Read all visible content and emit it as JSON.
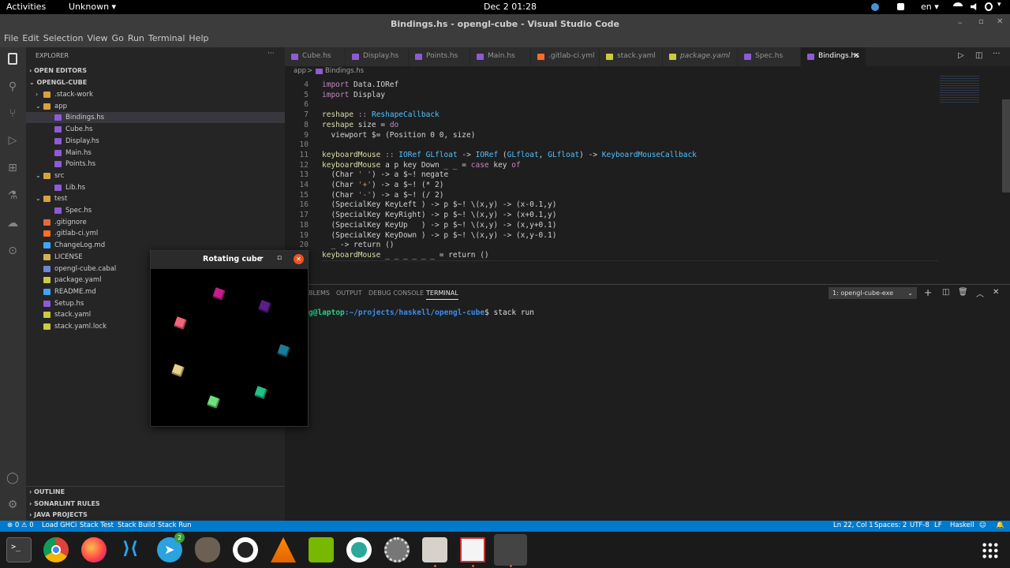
{
  "topbar": {
    "activities": "Activities",
    "app_menu": "Unknown ▾",
    "clock": "Dec 2  01:28",
    "lang": "en ▾",
    "status_icons": [
      "network-icon",
      "volume-icon",
      "power-icon"
    ]
  },
  "window": {
    "title": "Bindings.hs - opengl-cube - Visual Studio Code",
    "menu": [
      "File",
      "Edit",
      "Selection",
      "View",
      "Go",
      "Run",
      "Terminal",
      "Help"
    ]
  },
  "sidebar": {
    "header": "EXPLORER",
    "open_editors": "OPEN EDITORS",
    "project": "OPENGL-CUBE",
    "tree": [
      {
        "label": ".stack-work",
        "depth": 1,
        "type": "folder",
        "arrow": ">"
      },
      {
        "label": "app",
        "depth": 1,
        "type": "folder",
        "arrow": "v"
      },
      {
        "label": "Bindings.hs",
        "depth": 2,
        "type": "hs",
        "selected": true
      },
      {
        "label": "Cube.hs",
        "depth": 2,
        "type": "hs"
      },
      {
        "label": "Display.hs",
        "depth": 2,
        "type": "hs"
      },
      {
        "label": "Main.hs",
        "depth": 2,
        "type": "hs"
      },
      {
        "label": "Points.hs",
        "depth": 2,
        "type": "hs"
      },
      {
        "label": "src",
        "depth": 1,
        "type": "folder",
        "arrow": "v"
      },
      {
        "label": "Lib.hs",
        "depth": 2,
        "type": "hs"
      },
      {
        "label": "test",
        "depth": 1,
        "type": "folder",
        "arrow": "v"
      },
      {
        "label": "Spec.hs",
        "depth": 2,
        "type": "hs"
      },
      {
        "label": ".gitignore",
        "depth": 1,
        "type": "git"
      },
      {
        "label": ".gitlab-ci.yml",
        "depth": 1,
        "type": "gitlab"
      },
      {
        "label": "ChangeLog.md",
        "depth": 1,
        "type": "md"
      },
      {
        "label": "LICENSE",
        "depth": 1,
        "type": "license"
      },
      {
        "label": "opengl-cube.cabal",
        "depth": 1,
        "type": "cabal"
      },
      {
        "label": "package.yaml",
        "depth": 1,
        "type": "yaml"
      },
      {
        "label": "README.md",
        "depth": 1,
        "type": "md"
      },
      {
        "label": "Setup.hs",
        "depth": 1,
        "type": "hs"
      },
      {
        "label": "stack.yaml",
        "depth": 1,
        "type": "yaml"
      },
      {
        "label": "stack.yaml.lock",
        "depth": 1,
        "type": "yaml"
      }
    ],
    "bottom_sections": [
      "OUTLINE",
      "SONARLINT RULES",
      "JAVA PROJECTS"
    ]
  },
  "tabs": [
    {
      "label": "Cube.hs",
      "type": "hs"
    },
    {
      "label": "Display.hs",
      "type": "hs"
    },
    {
      "label": "Points.hs",
      "type": "hs"
    },
    {
      "label": "Main.hs",
      "type": "hs"
    },
    {
      "label": ".gitlab-ci.yml",
      "type": "gitlab"
    },
    {
      "label": "stack.yaml",
      "type": "yaml"
    },
    {
      "label": "package.yaml",
      "type": "yaml"
    },
    {
      "label": "Spec.hs",
      "type": "hs"
    },
    {
      "label": "Bindings.hs",
      "type": "hs",
      "active": true
    }
  ],
  "breadcrumb": {
    "folder": "app",
    "sep": ">",
    "file": "Bindings.hs"
  },
  "code_lines": [
    {
      "n": "4",
      "html": "<span class=\"kw\">import</span> Data.IORef"
    },
    {
      "n": "5",
      "html": "<span class=\"kw\">import</span> Display"
    },
    {
      "n": "6",
      "html": ""
    },
    {
      "n": "7",
      "html": "<span class=\"fn\">reshape</span> <span class=\"kw\">::</span> <span class=\"cb\">ReshapeCallback</span>"
    },
    {
      "n": "8",
      "html": "<span class=\"fn\">reshape</span> size = <span class=\"kw\">do</span>"
    },
    {
      "n": "9",
      "html": "  viewport $= (Position 0 0, size)"
    },
    {
      "n": "10",
      "html": ""
    },
    {
      "n": "11",
      "html": "<span class=\"fn\">keyboardMouse</span> <span class=\"kw\">::</span> <span class=\"cb\">IORef</span> <span class=\"cb\">GLfloat</span> -> <span class=\"cb\">IORef</span> (<span class=\"cb\">GLfloat</span>, <span class=\"cb\">GLfloat</span>) -> <span class=\"cb\">KeyboardMouseCallback</span>"
    },
    {
      "n": "12",
      "html": "<span class=\"fn\">keyboardMouse</span> a p key Down _ _ = <span class=\"kw\">case</span> key <span class=\"kw\">of</span>"
    },
    {
      "n": "13",
      "html": "  (Char <span class=\"st\">' '</span>) -> a $~! negate"
    },
    {
      "n": "14",
      "html": "  (Char <span class=\"st\">'+'</span>) -> a $~! (* 2)"
    },
    {
      "n": "15",
      "html": "  (Char <span class=\"st\">'-'</span>) -> a $~! (/ 2)"
    },
    {
      "n": "16",
      "html": "  (SpecialKey KeyLeft ) -> p $~! \\(x,y) -> (x-0.1,y)"
    },
    {
      "n": "17",
      "html": "  (SpecialKey KeyRight) -> p $~! \\(x,y) -> (x+0.1,y)"
    },
    {
      "n": "18",
      "html": "  (SpecialKey KeyUp   ) -> p $~! \\(x,y) -> (x,y+0.1)"
    },
    {
      "n": "19",
      "html": "  (SpecialKey KeyDown ) -> p $~! \\(x,y) -> (x,y-0.1)"
    },
    {
      "n": "20",
      "html": "  _ -> return ()"
    },
    {
      "n": "21",
      "html": "<span class=\"fn\">keyboardMouse</span> _ _ _ _ _ _ = return ()"
    },
    {
      "n": "22",
      "html": ""
    }
  ],
  "panel": {
    "tabs": [
      "BLEMS",
      "OUTPUT",
      "DEBUG CONSOLE",
      "TERMINAL"
    ],
    "active_tab": "TERMINAL",
    "terminal_select": "1: opengl-cube-exe",
    "prompt_user": "g@laptop",
    "prompt_path": ":~/projects/haskell/opengl-cube",
    "prompt_cmd": "$ stack run"
  },
  "statusbar": {
    "problems": "⊗ 0 ⚠ 0",
    "items_left": [
      "Load GHCi",
      "Stack Test",
      "Stack Build",
      "Stack Run"
    ],
    "cursor": "Ln 22, Col 1",
    "spaces": "Spaces: 2",
    "encoding": "UTF-8",
    "eol": "LF",
    "language": "Haskell"
  },
  "cube_window": {
    "title": "Rotating cube",
    "cubes": [
      {
        "color": "#c41e8a"
      },
      {
        "color": "#5b1f8a"
      },
      {
        "color": "#f0667a"
      },
      {
        "color": "#1a7d96"
      },
      {
        "color": "#e8cf8a"
      },
      {
        "color": "#22c185"
      },
      {
        "color": "#6ee07a"
      }
    ]
  },
  "dock": {
    "apps": [
      "terminal-icon",
      "chrome-icon",
      "firefox-icon",
      "vscode-icon",
      "telegram-icon",
      "gimp-icon",
      "obs-icon",
      "vlc-icon",
      "nvidia-icon",
      "remote-icon",
      "settings-icon",
      "files-icon",
      "editor-icon",
      "active-window-icon"
    ],
    "telegram_badge": "2",
    "grid_icon": "app-grid-icon"
  },
  "colors": {
    "accent": "#007acc",
    "editor_bg": "#1e1e1e",
    "sidebar_bg": "#252526"
  }
}
